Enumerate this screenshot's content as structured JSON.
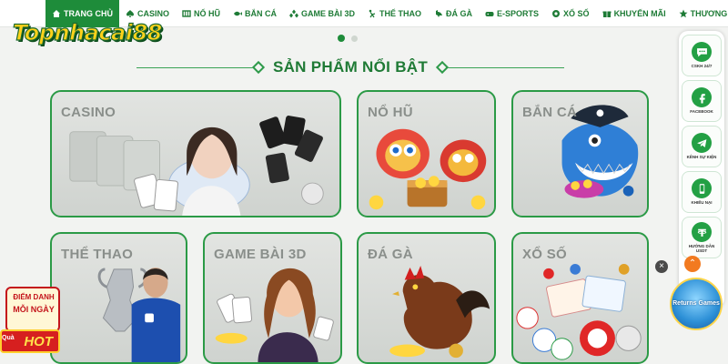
{
  "brand": {
    "logo_text": "Topnhacai88",
    "accent": "#1e8c3a",
    "card_border": "#2b9a46",
    "logo_fill": "#ffd21a"
  },
  "nav": {
    "items": [
      {
        "label": "TRANG CHỦ",
        "icon": "home-icon",
        "active": true
      },
      {
        "label": "CASINO",
        "icon": "casino-icon",
        "active": false
      },
      {
        "label": "NỔ HŨ",
        "icon": "slot-icon",
        "active": false
      },
      {
        "label": "BẮN CÁ",
        "icon": "fish-icon",
        "active": false
      },
      {
        "label": "GAME BÀI 3D",
        "icon": "cards-icon",
        "active": false
      },
      {
        "label": "THỂ THAO",
        "icon": "sport-icon",
        "active": false
      },
      {
        "label": "ĐÁ GÀ",
        "icon": "rooster-icon",
        "active": false
      },
      {
        "label": "E-SPORTS",
        "icon": "gamepad-icon",
        "active": false
      },
      {
        "label": "XỔ SỐ",
        "icon": "lottery-icon",
        "active": false
      },
      {
        "label": "KHUYẾN MÃI",
        "icon": "gift-icon",
        "active": false
      },
      {
        "label": "THƯƠNG HIỆU",
        "icon": "brand-icon",
        "active": false
      }
    ]
  },
  "carousel": {
    "dots": 2,
    "active_index": 0
  },
  "section": {
    "title": "SẢN PHẨM NỔI BẬT"
  },
  "products": [
    {
      "label": "CASINO",
      "art": "casino-dealer-cards"
    },
    {
      "label": "NỔ HŨ",
      "art": "lion-dance-treasure"
    },
    {
      "label": "BẮN CÁ",
      "art": "shark-pirate"
    },
    {
      "label": "THỂ THAO",
      "art": "football-player-trophy"
    },
    {
      "label": "GAME BÀI 3D",
      "art": "girl-with-cards"
    },
    {
      "label": "ĐÁ GÀ",
      "art": "fighting-rooster"
    },
    {
      "label": "XỔ SỐ",
      "art": "lottery-balls"
    }
  ],
  "sidebar": {
    "items": [
      {
        "label": "CSKH 24/7",
        "icon": "chat-support-icon"
      },
      {
        "label": "FACEBOOK",
        "icon": "facebook-icon"
      },
      {
        "label": "KÊNH SỰ KIỆN",
        "icon": "telegram-icon"
      },
      {
        "label": "KHIẾU NẠI",
        "icon": "phone-icon"
      },
      {
        "label": "HƯỚNG DẪN USDT",
        "icon": "usdt-icon"
      }
    ],
    "close_glyph": "×",
    "up_glyph": "⌃"
  },
  "floating_banner": {
    "text": "Returns Games"
  },
  "daily_promo": {
    "line1": "ĐIỂM DANH",
    "line2": "MỖI NGÀY",
    "prefix": "Quà",
    "hot": "HOT"
  }
}
